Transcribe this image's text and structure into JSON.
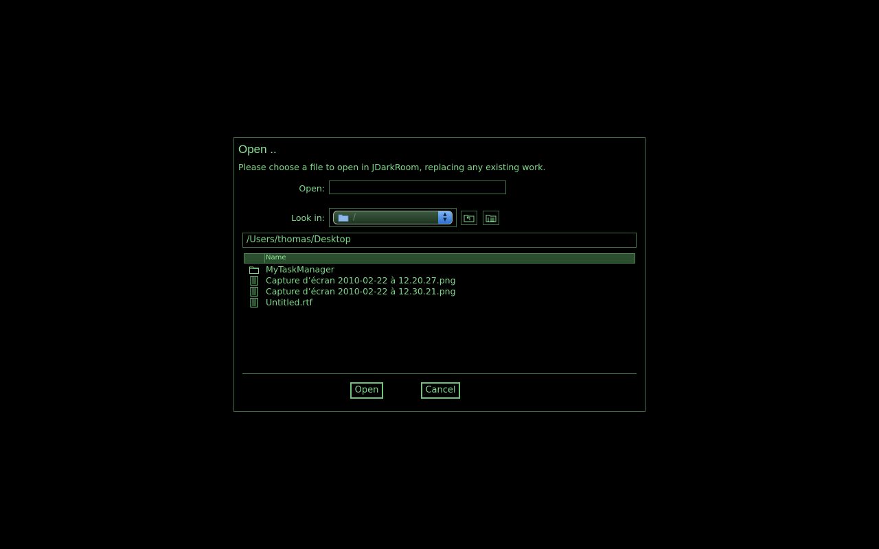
{
  "dialog": {
    "title": "Open ..",
    "instructions": "Please choose a file to open in JDarkRoom, replacing any existing work."
  },
  "open_field": {
    "label": "Open:",
    "value": ""
  },
  "look_in": {
    "label": "Look in:",
    "selected": "/"
  },
  "path": "/Users/thomas/Desktop",
  "file_list": {
    "column_header": "Name",
    "items": [
      {
        "name": "MyTaskManager",
        "type": "folder"
      },
      {
        "name": "Capture d’écran 2010-02-22 à 12.20.27.png",
        "type": "file"
      },
      {
        "name": "Capture d’écran 2010-02-22 à 12.30.21.png",
        "type": "file"
      },
      {
        "name": "Untitled.rtf",
        "type": "file"
      }
    ]
  },
  "buttons": {
    "open": "Open",
    "cancel": "Cancel"
  },
  "icons": {
    "up_folder": "up-folder-icon",
    "details_view": "details-view-icon",
    "folder": "folder-icon",
    "file": "file-icon"
  },
  "colors": {
    "background": "#000000",
    "text": "#7fd88a",
    "border": "#3f7046",
    "header_bg": "#2a4e2e"
  }
}
